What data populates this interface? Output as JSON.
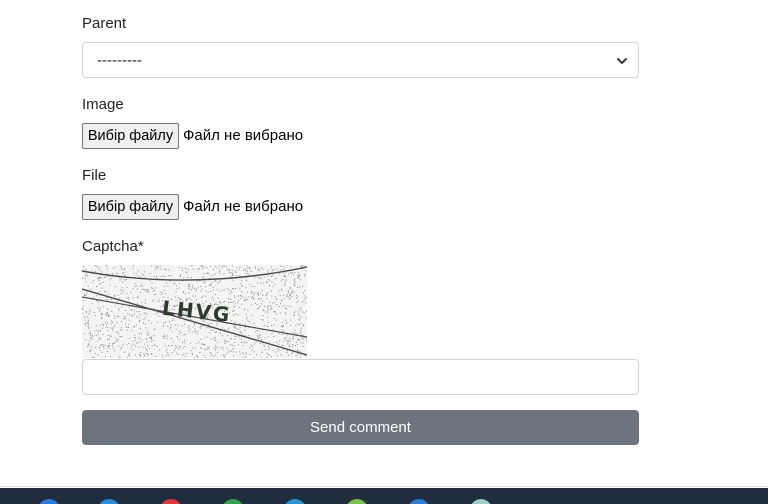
{
  "form": {
    "parent": {
      "label": "Parent",
      "selected": "---------"
    },
    "image": {
      "label": "Image",
      "button": "Вибір файлу",
      "status": "Файл не вибрано"
    },
    "file": {
      "label": "File",
      "button": "Вибір файлу",
      "status": "Файл не вибрано"
    },
    "captcha": {
      "label": "Captcha*",
      "image_text": "LHVG",
      "input_value": ""
    },
    "submit_label": "Send comment"
  },
  "colors": {
    "button": "#6c757d",
    "border": "#ced4da",
    "taskbar": "#1f2d3f"
  },
  "taskbar": {
    "icons": [
      {
        "name": "windows-icon",
        "color": "#2f7bd8"
      },
      {
        "name": "explorer-icon",
        "color": "#2a8de0"
      },
      {
        "name": "opera-icon",
        "color": "#e0383e"
      },
      {
        "name": "chrome-icon",
        "color": "#2fa34a"
      },
      {
        "name": "edge-icon",
        "color": "#2a95d6"
      },
      {
        "name": "notes-icon",
        "color": "#7cc04a"
      },
      {
        "name": "vscode-icon",
        "color": "#2b7fd4"
      },
      {
        "name": "app-icon",
        "color": "#9ad0c8"
      }
    ]
  }
}
